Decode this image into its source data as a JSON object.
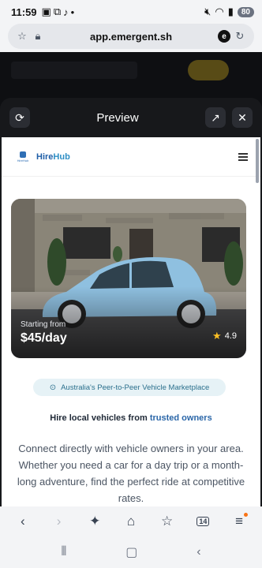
{
  "status_bar": {
    "time": "11:59",
    "notification_icons": [
      "gallery-icon",
      "screenshot-icon",
      "tiktok-icon",
      "dot-icon"
    ],
    "battery": "80"
  },
  "browser": {
    "url": "app.emergent.sh"
  },
  "preview_modal": {
    "title": "Preview"
  },
  "site": {
    "logo_small_text": "HireHub",
    "brand_part1": "Hire",
    "brand_part2": "Hub",
    "hero": {
      "starting_label": "Starting from",
      "price": "$45/day",
      "rating": "4.9"
    },
    "badge": "Australia's Peer-to-Peer Vehicle Marketplace",
    "tagline_part1": "Hire local vehicles from ",
    "tagline_highlight": "trusted owners",
    "description": "Connect directly with vehicle owners in your area. Whether you need a car for a day trip or a month-long adventure, find the perfect ride at competitive rates."
  },
  "toolbar": {
    "tabs_count": "14"
  },
  "colors": {
    "brand_blue": "#1f5fa8",
    "accent_teal": "#2a6f8c",
    "modal_bg": "#17181b"
  }
}
